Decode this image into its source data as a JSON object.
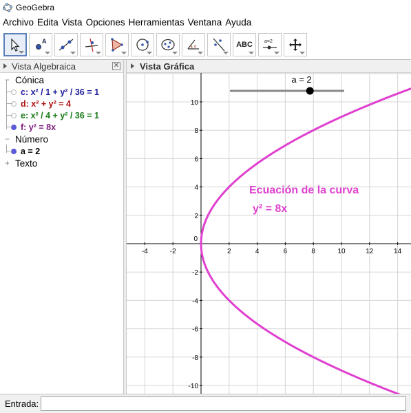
{
  "window": {
    "title": "GeoGebra",
    "icon": "geogebra-icon"
  },
  "menubar": {
    "items": [
      "Archivo",
      "Edita",
      "Vista",
      "Opciones",
      "Herramientas",
      "Ventana",
      "Ayuda"
    ]
  },
  "toolbar": {
    "tools": [
      {
        "icon": "move-arrow-icon",
        "selected": true
      },
      {
        "icon": "new-point-icon"
      },
      {
        "icon": "line-through-two-points-icon"
      },
      {
        "icon": "perpendicular-line-icon"
      },
      {
        "icon": "polygon-icon"
      },
      {
        "icon": "circle-center-point-icon"
      },
      {
        "icon": "ellipse-icon"
      },
      {
        "icon": "angle-icon"
      },
      {
        "icon": "reflect-about-line-icon"
      },
      {
        "icon": "text-icon",
        "label": "ABC"
      },
      {
        "icon": "slider-icon",
        "label": "a=2"
      },
      {
        "icon": "move-graphics-view-icon"
      }
    ]
  },
  "algebra_view": {
    "title": "Vista Algebraica",
    "categories": [
      {
        "name": "Cónica",
        "items": [
          {
            "text": "c: x² / 1 + y² / 36 = 1",
            "color": "#1a1a9c",
            "visible": false
          },
          {
            "text": "d: x² + y² = 4",
            "color": "#b01010",
            "visible": false
          },
          {
            "text": "e: x² / 4 + y² / 36 = 1",
            "color": "#1a7a1a",
            "visible": false
          },
          {
            "text": "f: y² = 8x",
            "color": "#7a1a7a",
            "visible": true
          }
        ]
      },
      {
        "name": "Número",
        "items": [
          {
            "text": "a = 2",
            "color": "#000000",
            "visible": true
          }
        ]
      },
      {
        "name": "Texto",
        "items": []
      }
    ]
  },
  "graphics_view": {
    "title": "Vista Gráfica",
    "slider_label": "a = 2",
    "slider_value": 2,
    "slider_min": -5,
    "slider_max": 5,
    "annotation_line1": "Ecuación de la curva",
    "annotation_line2": "y² = 8x",
    "curve_color": "#e040d0",
    "x_ticks": [
      "-4",
      "-2",
      "0",
      "2",
      "4",
      "6",
      "8",
      "10",
      "12",
      "14"
    ],
    "y_ticks": [
      "10",
      "8",
      "6",
      "4",
      "2",
      "-2",
      "-4",
      "-6",
      "-8",
      "-10"
    ]
  },
  "input_bar": {
    "label": "Entrada:",
    "value": "",
    "placeholder": ""
  }
}
